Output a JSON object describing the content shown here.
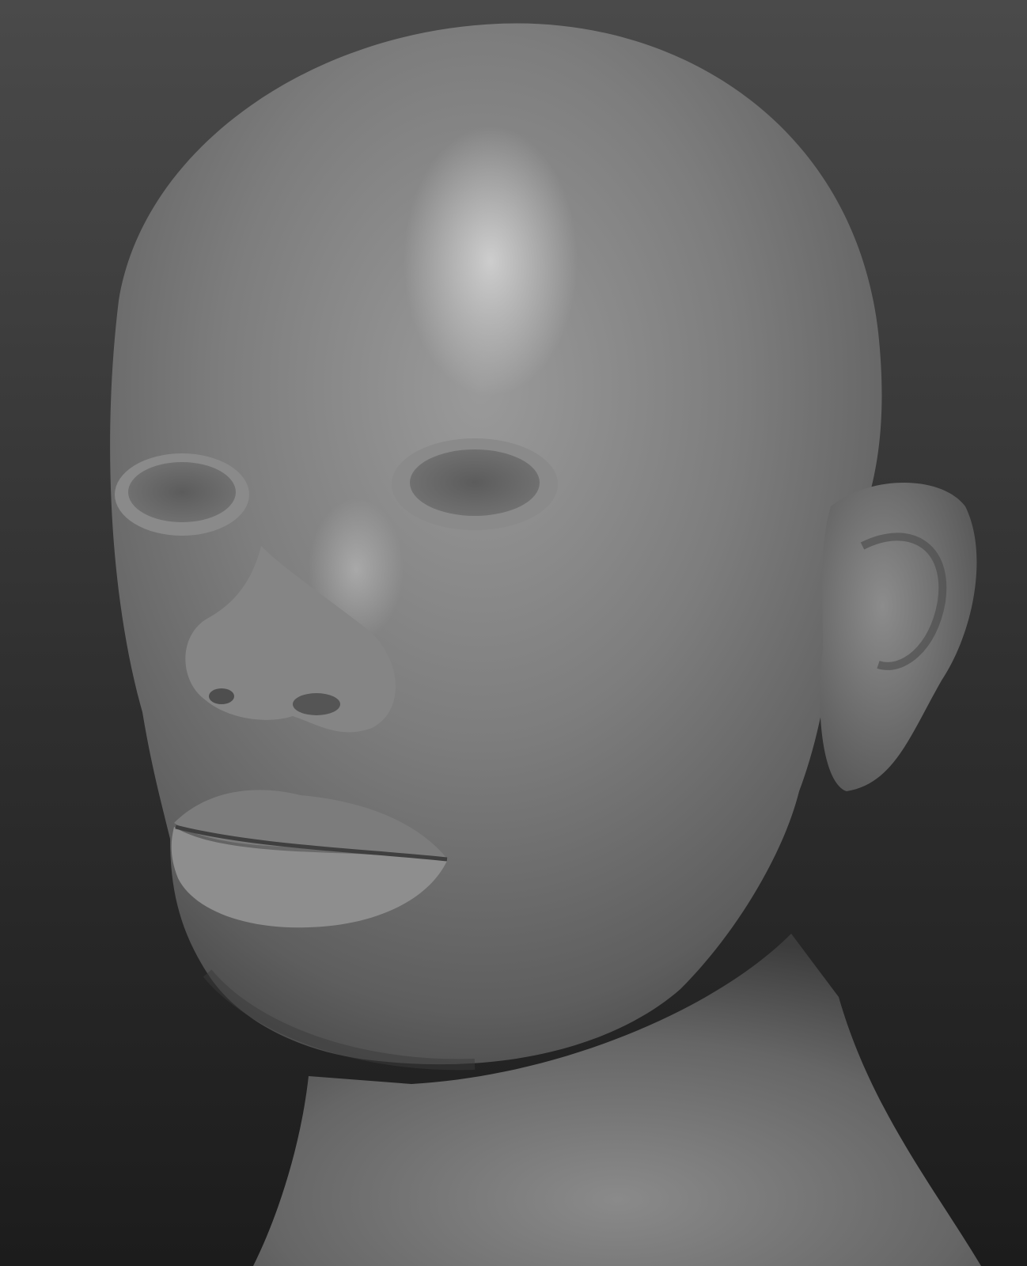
{
  "viewport": {
    "background_top": "#4a4a4a",
    "background_bottom": "#1c1c1c",
    "model_color": "#7b7b7b",
    "model": "sculpted-head-bust",
    "material": "matcap-gray"
  }
}
